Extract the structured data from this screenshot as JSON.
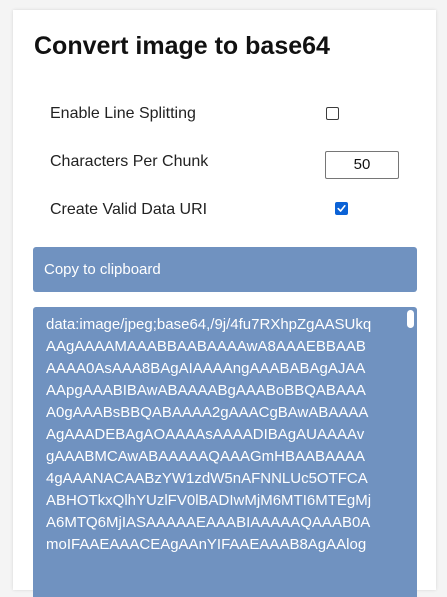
{
  "title": "Convert image to base64",
  "options": {
    "line_splitting": {
      "label": "Enable Line Splitting",
      "checked": false
    },
    "chunk_size": {
      "label": "Characters Per Chunk",
      "value": "50"
    },
    "data_uri": {
      "label": "Create Valid Data URI",
      "checked": true
    }
  },
  "copy_button": {
    "label": "Copy to clipboard"
  },
  "output": {
    "lines": [
      "data:image/jpeg;base64,/9j/4fu7RXhpZgAASUkq",
      "AAgAAAAMAAABBAABAAAAwA8AAAEBBAAB",
      "AAAA0AsAAA8BAgAIAAAAngAAABABAgAJAA",
      "AApgAAABIBAwABAAAABgAAABoBBQABAAA",
      "A0gAAABsBBQABAAAA2gAAACgBAwABAAAA",
      "AgAAADEBAgAOAAAAsAAAADIBAgAUAAAAv",
      "gAAABMCAwABAAAAAQAAAGmHBAABAAAA",
      "4gAAANACAABzYW1zdW5nAFNNLUc5OTFCA",
      "ABHOTkxQlhYUzlFV0lBADIwMjM6MTI6MTEgMj",
      "A6MTQ6MjIASAAAAAEAAABIAAAAAQAAAB0A",
      "moIFAAEAAACEAgAAnYIFAAEAAAB8AgAAlog"
    ]
  },
  "colors": {
    "accent": "#7092c0",
    "checkbox_checked": "#0b62d6",
    "text_on_accent": "#ffffff"
  },
  "icons": {
    "checkmark": "check-icon"
  }
}
